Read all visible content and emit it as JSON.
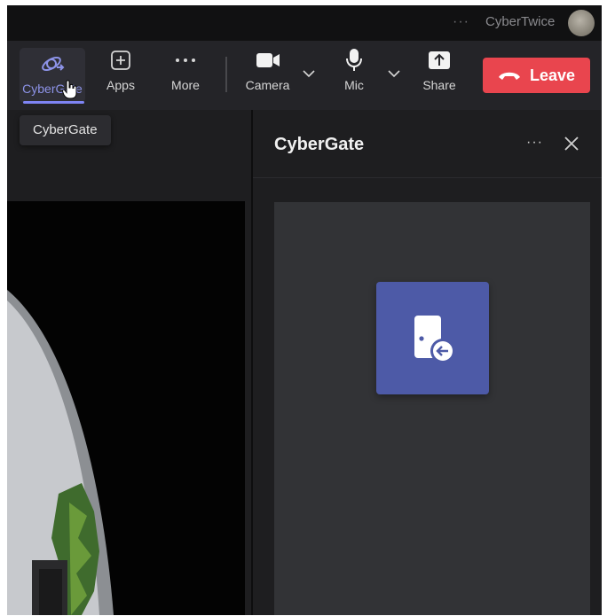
{
  "titlebar": {
    "more": "···",
    "user_name": "CyberTwice"
  },
  "toolbar": {
    "items": [
      {
        "label": "CyberGate",
        "icon": "cybergate-app-icon"
      },
      {
        "label": "Apps",
        "icon": "plus-square-icon"
      },
      {
        "label": "More",
        "icon": "more-dots-icon"
      },
      {
        "label": "Camera",
        "icon": "camera-icon"
      },
      {
        "label": "Mic",
        "icon": "microphone-icon"
      },
      {
        "label": "Share",
        "icon": "share-upload-icon"
      }
    ],
    "leave_label": "Leave",
    "leave_color": "#e9454e",
    "accent_color": "#7f85f5"
  },
  "tooltip": {
    "text": "CyberGate"
  },
  "panel": {
    "title": "CyberGate",
    "more": "···",
    "app_icon": "door-enter-icon"
  }
}
